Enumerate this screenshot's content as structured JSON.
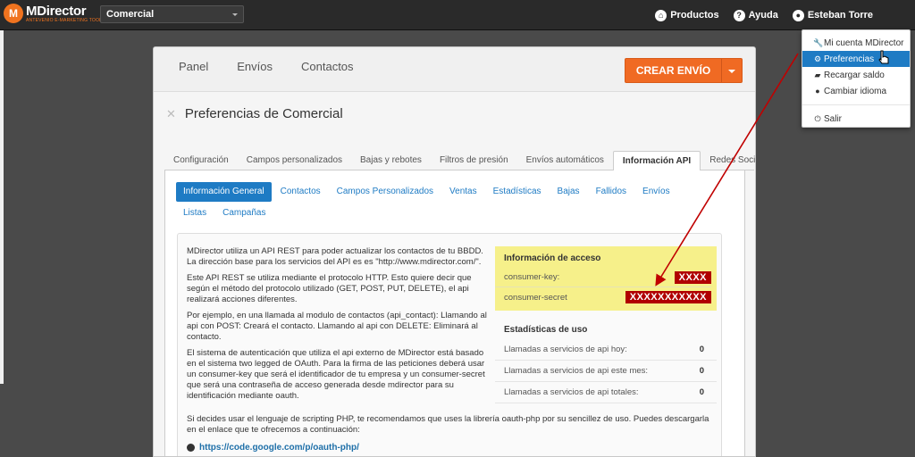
{
  "brand": {
    "name": "MDirector",
    "tagline": "ANTEVENIO E-MARKETING TOOL"
  },
  "account_select": {
    "value": "Comercial"
  },
  "top_nav": {
    "products": "Productos",
    "help": "Ayuda",
    "user": "Esteban Torre"
  },
  "user_menu": {
    "items": [
      {
        "icon": "wrench-icon",
        "label": "Mi cuenta MDirector"
      },
      {
        "icon": "gear-icon",
        "label": "Preferencias"
      },
      {
        "icon": "cart-icon",
        "label": "Recargar saldo"
      },
      {
        "icon": "globe-icon",
        "label": "Cambiar idioma"
      }
    ],
    "logout": "Salir"
  },
  "main_nav": {
    "items": [
      "Panel",
      "Envíos",
      "Contactos"
    ]
  },
  "cta": {
    "label": "CREAR ENVÍO"
  },
  "page_title": "Preferencias de Comercial",
  "tabs": [
    "Configuración",
    "Campos personalizados",
    "Bajas y rebotes",
    "Filtros de presión",
    "Envíos automáticos",
    "Información API",
    "Redes Sociales"
  ],
  "active_tab": "Información API",
  "sub_tabs": [
    "Información General",
    "Contactos",
    "Campos Personalizados",
    "Ventas",
    "Estadísticas",
    "Bajas",
    "Fallidos",
    "Envíos",
    "Listas",
    "Campañas"
  ],
  "description": {
    "p1": "MDirector utiliza un API REST para poder actualizar los contactos de tu BBDD. La dirección base para los servicios del API es es \"http://www.mdirector.com/\".",
    "p2": "Este API REST se utiliza mediante el protocolo HTTP. Esto quiere decir que según el método del protocolo utilizado (GET, POST, PUT, DELETE), el api realizará acciones diferentes.",
    "p3": "Por ejemplo, en una llamada al modulo de contactos (api_contact): Llamando al api con POST: Creará el contacto. Llamando al api con DELETE: Eliminará al contacto.",
    "p4": "El sistema de autenticación que utiliza el api externo de MDirector está basado en el sistema two legged de OAuth. Para la firma de las peticiones deberá usar un consumer-key que será el identificador de tu empresa y un consumer-secret que será una contraseña de acceso generada desde mdirector para su identificación mediante oauth.",
    "p5": "Si decides usar el lenguaje de scripting PHP, te recomendamos que uses la librería oauth-php por su sencillez de uso. Puedes descargarla en el enlace que te ofrecemos a continuación:",
    "link": "https://code.google.com/p/oauth-php/"
  },
  "access": {
    "title": "Información de acceso",
    "consumer_key_label": "consumer-key:",
    "consumer_key_value": "XXXX",
    "consumer_secret_label": "consumer-secret",
    "consumer_secret_value": "XXXXXXXXXXX"
  },
  "stats": {
    "title": "Estadísticas de uso",
    "rows": [
      {
        "label": "Llamadas a servicios de api hoy:",
        "value": "0"
      },
      {
        "label": "Llamadas a servicios de api este mes:",
        "value": "0"
      },
      {
        "label": "Llamadas a servicios de api totales:",
        "value": "0"
      }
    ]
  },
  "colors": {
    "accent": "#1e7bc4",
    "cta": "#f06a23",
    "highlight": "#f6f08a",
    "secret": "#b00000",
    "arrow": "#c00000"
  }
}
